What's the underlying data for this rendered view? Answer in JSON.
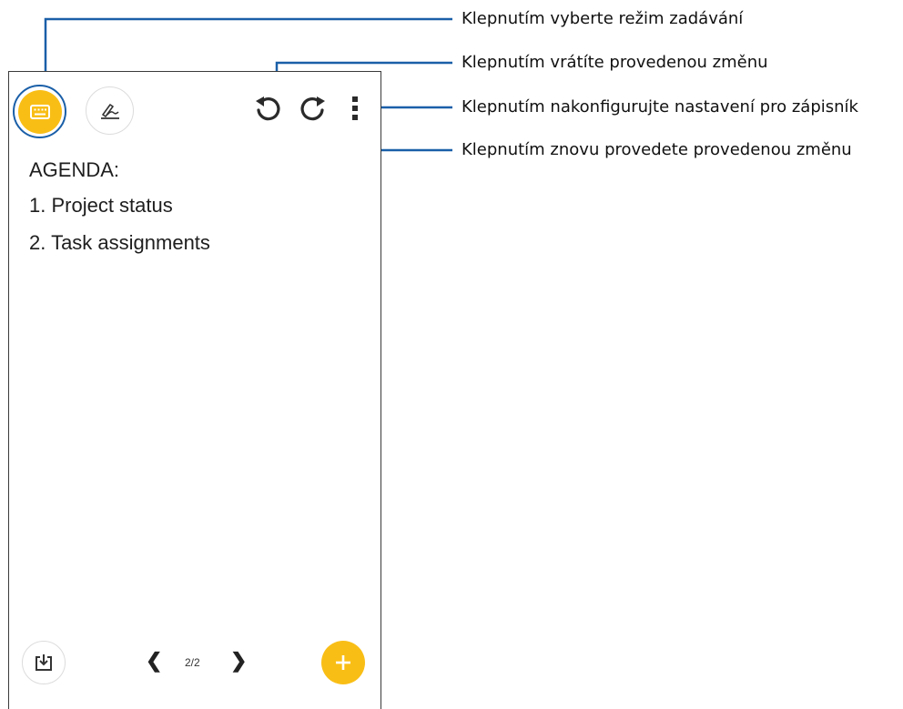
{
  "callouts": {
    "input_mode": "Klepnutím vyberte režim zadávání",
    "undo": "Klepnutím vrátíte provedenou změnu",
    "settings": "Klepnutím nakonfigurujte nastavení pro zápisník",
    "redo": "Klepnutím znovu provedete provedenou změnu"
  },
  "note": {
    "lines": [
      "AGENDA:",
      "1. Project status",
      "2. Task assignments"
    ]
  },
  "footer": {
    "page_indicator": "2/2",
    "prev": "❮",
    "next": "❯"
  },
  "icons": {
    "keyboard": "keyboard-icon",
    "handwriting": "handwriting-icon",
    "undo": "undo-icon",
    "redo": "redo-icon",
    "more": "more-vertical-icon",
    "import": "import-icon",
    "add": "add-icon"
  },
  "colors": {
    "accent": "#F9BE16",
    "callout_line": "#1a5fa8"
  }
}
